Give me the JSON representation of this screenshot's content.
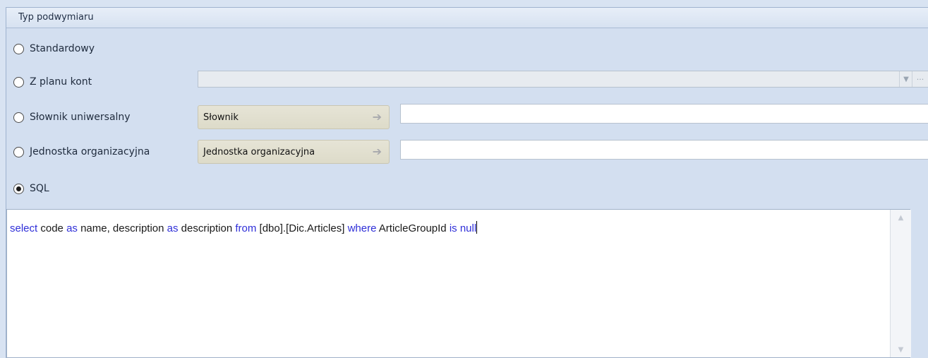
{
  "panel": {
    "title": "Typ podwymiaru"
  },
  "options": [
    {
      "label": "Standardowy",
      "checked": false
    },
    {
      "label": "Z planu kont",
      "checked": false
    },
    {
      "label": "Słownik uniwersalny",
      "checked": false
    },
    {
      "label": "Jednostka organizacyjna",
      "checked": false
    },
    {
      "label": "SQL",
      "checked": true
    }
  ],
  "account_plan": {
    "value": ""
  },
  "dictionary": {
    "button_label": "Słownik",
    "value": ""
  },
  "org_unit": {
    "button_label": "Jednostka organizacyjna",
    "value": ""
  },
  "sql": {
    "tokens": [
      {
        "t": "select",
        "kw": true
      },
      {
        "t": " code ",
        "kw": false
      },
      {
        "t": "as",
        "kw": true
      },
      {
        "t": " name, description ",
        "kw": false
      },
      {
        "t": "as",
        "kw": true
      },
      {
        "t": " description ",
        "kw": false
      },
      {
        "t": "from",
        "kw": true
      },
      {
        "t": " [dbo].[Dic.Articles] ",
        "kw": false
      },
      {
        "t": "where",
        "kw": true
      },
      {
        "t": " ArticleGroupId ",
        "kw": false
      },
      {
        "t": "is",
        "kw": true
      },
      {
        "t": " ",
        "kw": false
      },
      {
        "t": "null",
        "kw": true
      }
    ]
  },
  "icons": {
    "radio": "radio-button-icon",
    "arrow": "arrow-right-icon",
    "dropdown": "chevron-down-icon",
    "more": "ellipsis-icon"
  },
  "colors": {
    "keyword": "#2f2fd8",
    "panel_bg": "#d3dff0",
    "button_bg": "#e6e4d6"
  }
}
